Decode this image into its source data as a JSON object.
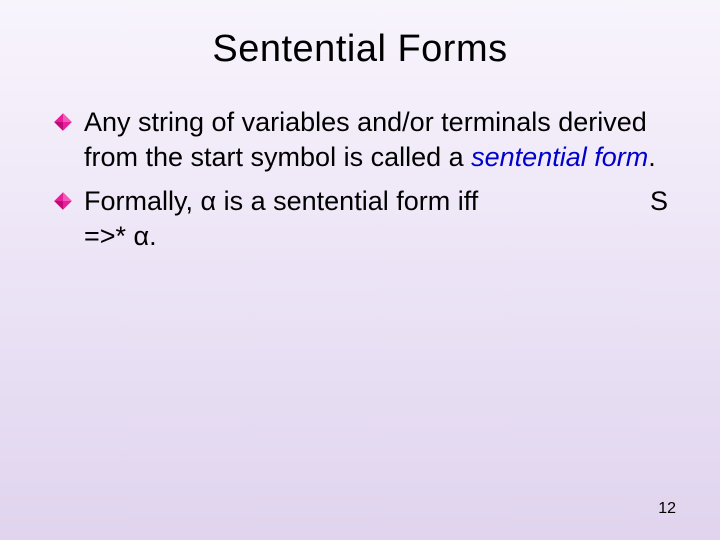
{
  "slide": {
    "title": "Sentential Forms",
    "bullets": [
      {
        "pre": "Any string of variables and/or terminals derived from the start symbol is called a ",
        "term": "sentential form",
        "post": "."
      },
      {
        "pre": "Formally, α is a sentential form iff",
        "trail_s": "S",
        "line2": "=>* α."
      }
    ],
    "page_number": "12"
  }
}
